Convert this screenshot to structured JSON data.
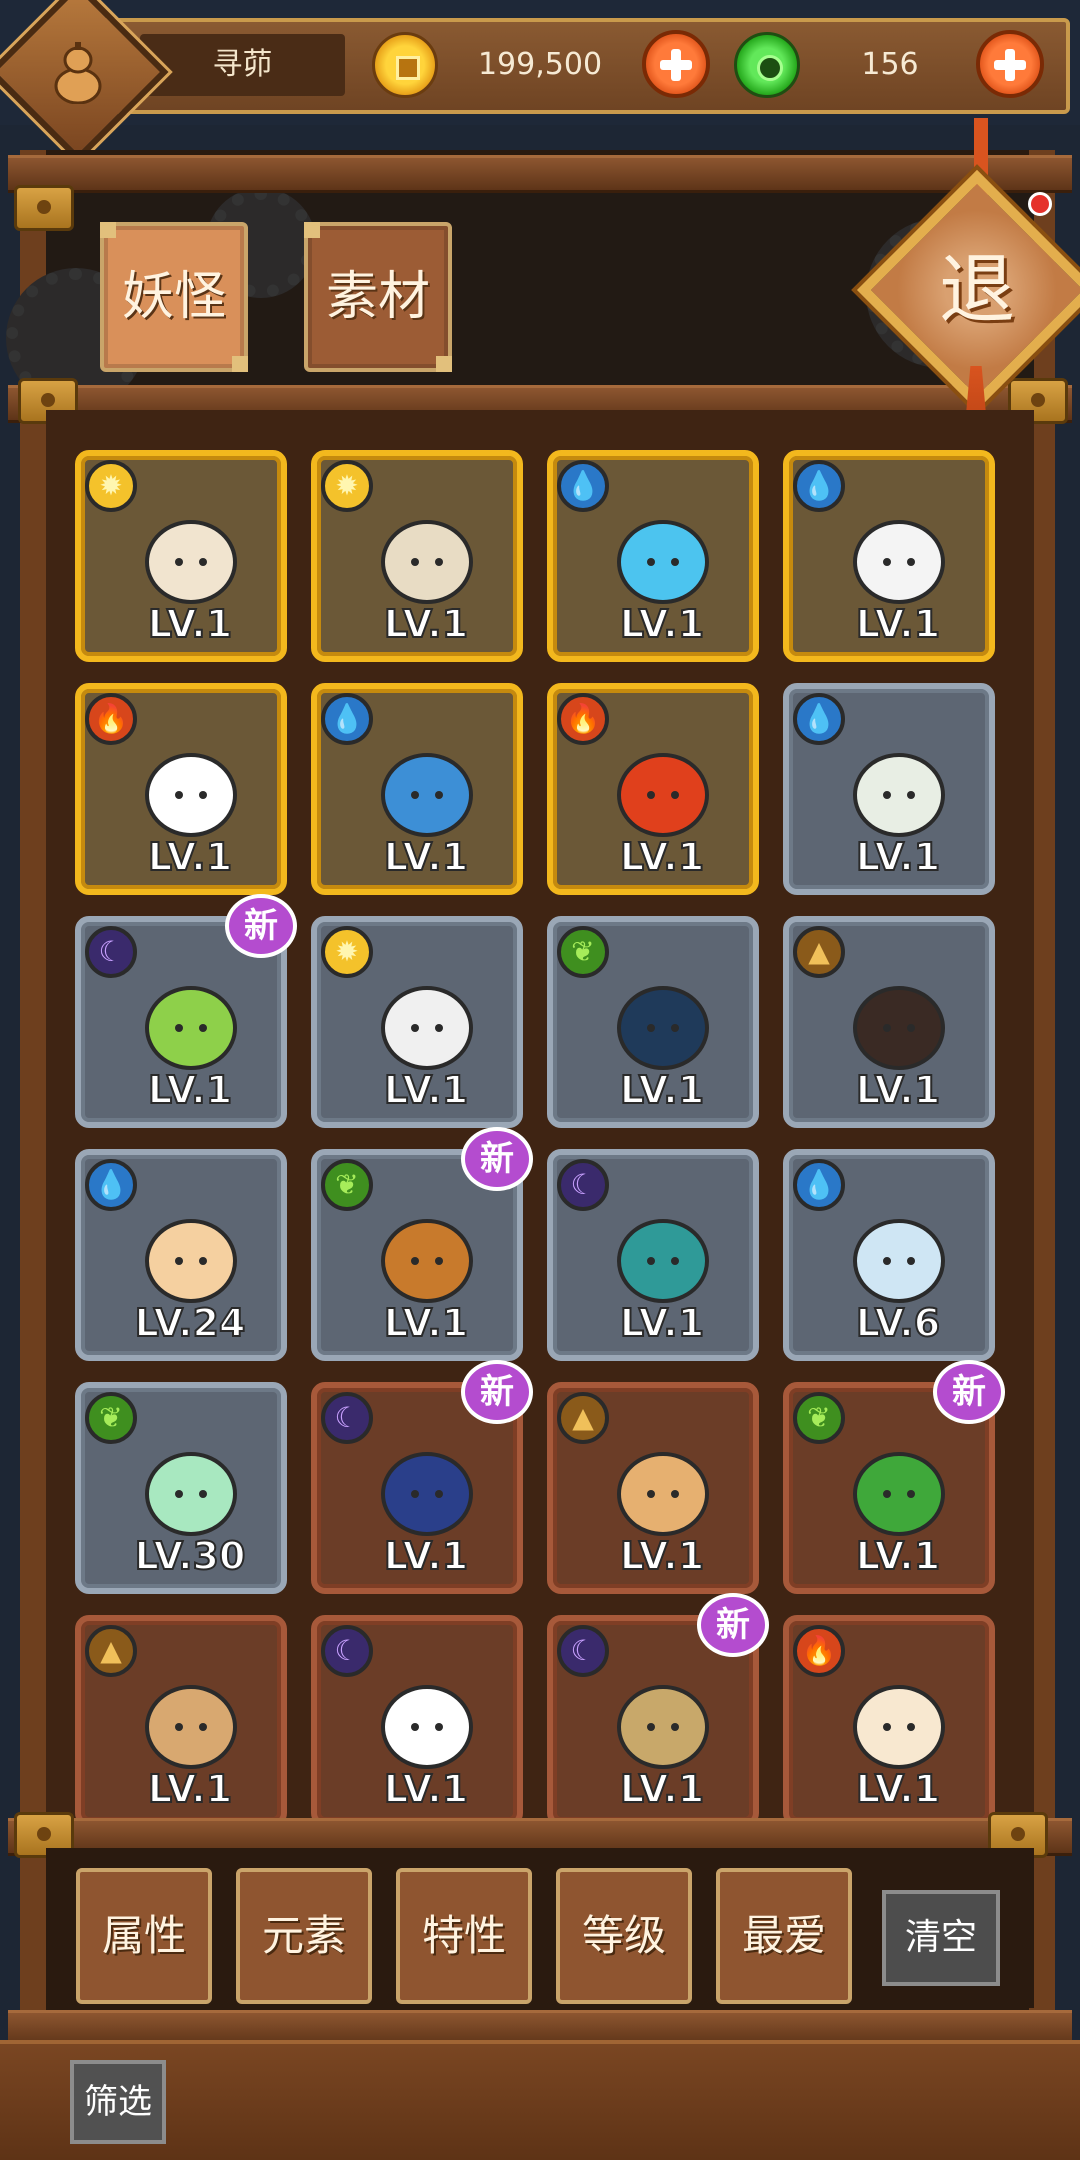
{
  "player": {
    "name": "寻茆"
  },
  "currency": {
    "coins": "199,500",
    "gems": "156"
  },
  "tabs": {
    "monsters": "妖怪",
    "materials": "素材"
  },
  "exit_label": "退",
  "badge_new": "新",
  "colors": {
    "gold": "#f3b81d",
    "silver": "#9aa7b6",
    "bronze": "#a7593a",
    "badge": "#b44ccf"
  },
  "monsters": [
    {
      "level": "LV.1",
      "element": "sun",
      "frame": "gold",
      "icon": "snow-globe-boy-icon",
      "is_new": false
    },
    {
      "level": "LV.1",
      "element": "sun",
      "frame": "gold",
      "icon": "snowman-icon",
      "is_new": false
    },
    {
      "level": "LV.1",
      "element": "water",
      "frame": "gold",
      "icon": "water-star-icon",
      "is_new": false
    },
    {
      "level": "LV.1",
      "element": "water",
      "frame": "gold",
      "icon": "antler-cloud-icon",
      "is_new": false
    },
    {
      "level": "LV.1",
      "element": "fire",
      "frame": "gold",
      "icon": "gift-box-icon",
      "is_new": false
    },
    {
      "level": "LV.1",
      "element": "water",
      "frame": "gold",
      "icon": "water-orb-icon",
      "is_new": false
    },
    {
      "level": "LV.1",
      "element": "fire",
      "frame": "gold",
      "icon": "fire-bird-icon",
      "is_new": false
    },
    {
      "level": "LV.1",
      "element": "water",
      "frame": "silver",
      "icon": "cotton-flower-icon",
      "is_new": false
    },
    {
      "level": "LV.1",
      "element": "moon",
      "frame": "silver",
      "icon": "green-sword-icon",
      "is_new": true
    },
    {
      "level": "LV.1",
      "element": "sun",
      "frame": "silver",
      "icon": "white-star-spirit-icon",
      "is_new": false
    },
    {
      "level": "LV.1",
      "element": "leaf",
      "frame": "silver",
      "icon": "book-spirit-icon",
      "is_new": false
    },
    {
      "level": "LV.1",
      "element": "earth",
      "frame": "silver",
      "icon": "crow-icon",
      "is_new": false
    },
    {
      "level": "LV.24",
      "element": "water",
      "frame": "silver",
      "icon": "ink-brush-icon",
      "is_new": false
    },
    {
      "level": "LV.1",
      "element": "leaf",
      "frame": "silver",
      "icon": "acorn-sprout-icon",
      "is_new": true
    },
    {
      "level": "LV.1",
      "element": "moon",
      "frame": "silver",
      "icon": "teal-ghost-icon",
      "is_new": false
    },
    {
      "level": "LV.6",
      "element": "water",
      "frame": "silver",
      "icon": "ice-crystal-icon",
      "is_new": false
    },
    {
      "level": "LV.30",
      "element": "leaf",
      "frame": "silver",
      "icon": "jade-crystal-icon",
      "is_new": false
    },
    {
      "level": "LV.1",
      "element": "moon",
      "frame": "bronze",
      "icon": "blue-swallow-icon",
      "is_new": true
    },
    {
      "level": "LV.1",
      "element": "earth",
      "frame": "bronze",
      "icon": "bun-icon",
      "is_new": false
    },
    {
      "level": "LV.1",
      "element": "leaf",
      "frame": "bronze",
      "icon": "mantis-icon",
      "is_new": true
    },
    {
      "level": "LV.1",
      "element": "earth",
      "frame": "bronze",
      "icon": "wicker-ball-icon",
      "is_new": false
    },
    {
      "level": "LV.1",
      "element": "moon",
      "frame": "bronze",
      "icon": "eyeball-icon",
      "is_new": false
    },
    {
      "level": "LV.1",
      "element": "moon",
      "frame": "bronze",
      "icon": "box-rat-icon",
      "is_new": true
    },
    {
      "level": "LV.1",
      "element": "fire",
      "frame": "bronze",
      "icon": "candle-icon",
      "is_new": false
    }
  ],
  "filters": {
    "attribute": "属性",
    "element": "元素",
    "trait": "特性",
    "level": "等级",
    "favorite": "最爱",
    "clear": "清空",
    "toggle": "筛选"
  }
}
